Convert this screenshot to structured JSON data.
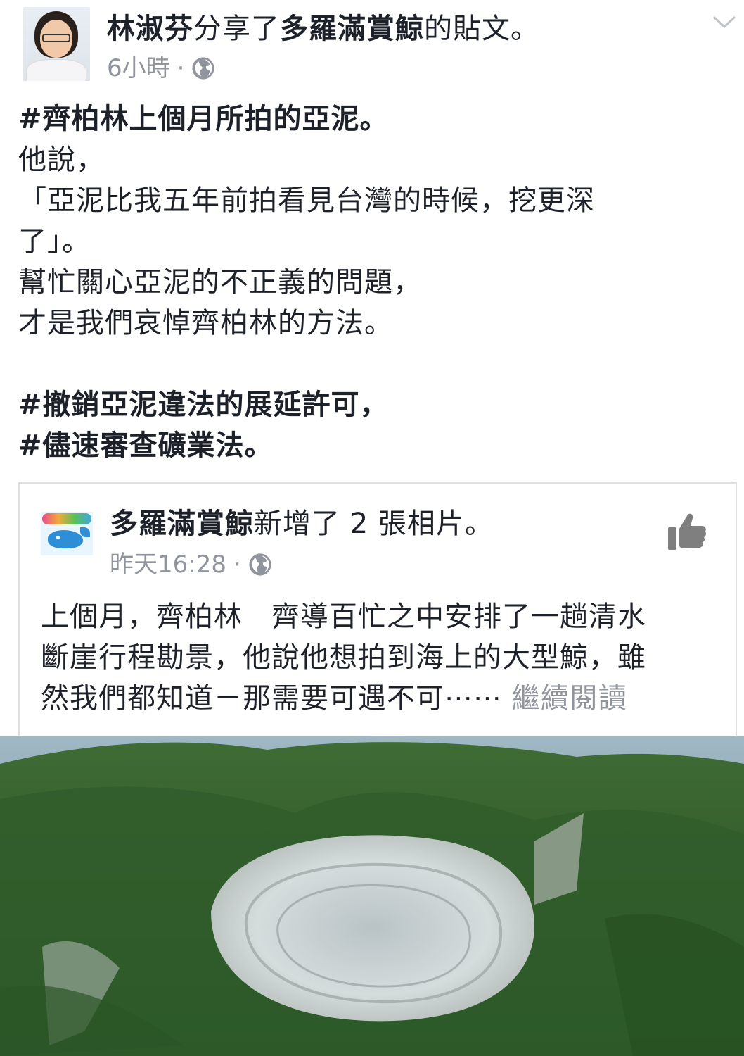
{
  "header": {
    "author": "林淑芬",
    "action_pre": "分享了",
    "shared_page": "多羅滿賞鯨",
    "action_post": "的貼文。",
    "time": "6小時",
    "dot": "·",
    "privacy_icon": "globe-icon",
    "menu_icon": "chevron-down-icon"
  },
  "body": {
    "lines": [
      "#齊柏林上個月所拍的亞泥。",
      "他說，",
      "「亞泥比我五年前拍看見台灣的時候，挖更深",
      "了」。",
      "幫忙關心亞泥的不正義的問題，",
      "才是我們哀悼齊柏林的方法。",
      "#撤銷亞泥違法的展延許可，",
      "#儘速審查礦業法。"
    ]
  },
  "shared_post": {
    "page_name": "多羅滿賞鯨",
    "action": "新增了 2 張相片。",
    "time": "昨天16:28",
    "dot": "·",
    "privacy_icon": "globe-icon",
    "like_icon": "thumbs-up-icon",
    "text_lines": [
      "上個月，齊柏林　齊導百忙之中安排了一趟清水",
      "斷崖行程勘景，他說他想拍到海上的大型鯨，雖",
      "然我們都知道－那需要可遇不可⋯⋯"
    ],
    "see_more": "繼續閱讀"
  },
  "colors": {
    "text": "#1d2129",
    "meta": "#90949c",
    "border": "#dddfe2"
  }
}
